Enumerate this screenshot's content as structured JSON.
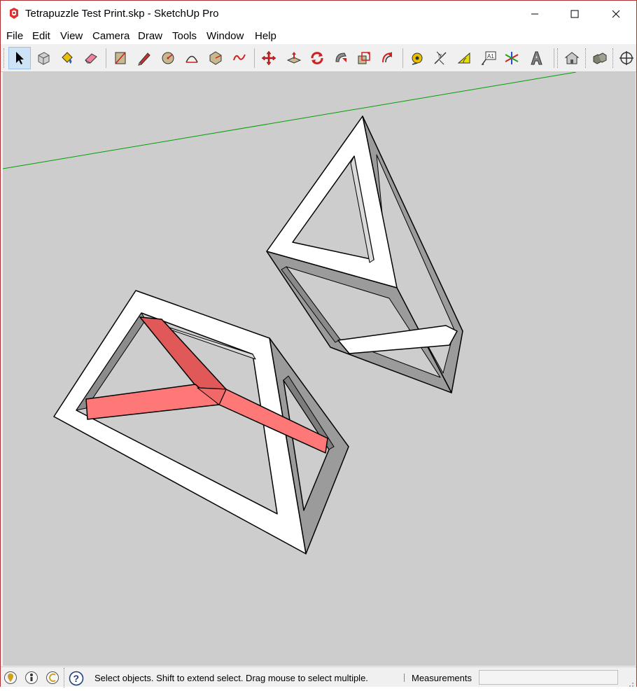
{
  "window": {
    "title": "Tetrapuzzle Test Print.skp - SketchUp Pro"
  },
  "titlebar_buttons": {
    "minimize": "minimize",
    "maximize": "maximize",
    "close": "close"
  },
  "menu": {
    "file": "File",
    "edit": "Edit",
    "view": "View",
    "camera": "Camera",
    "draw": "Draw",
    "tools": "Tools",
    "window": "Window",
    "help": "Help"
  },
  "toolbar": {
    "tools": [
      "select-tool",
      "make-component-tool",
      "paint-bucket-tool",
      "eraser-tool",
      "rectangle-tool",
      "line-tool",
      "circle-tool",
      "arc-tool",
      "polygon-tool",
      "freehand-tool",
      "move-tool",
      "push-pull-tool",
      "rotate-tool",
      "follow-me-tool",
      "scale-tool",
      "offset-tool",
      "tape-measure-tool",
      "dimension-tool",
      "protractor-tool",
      "text-tool",
      "axes-tool",
      "3d-text-tool",
      "warehouse-tool",
      "components-tool",
      "orbit-tool"
    ],
    "active_tool": "select-tool"
  },
  "status": {
    "message": "Select objects. Shift to extend select. Drag mouse to select multiple.",
    "measurements_label": "Measurements",
    "measurements_value": ""
  },
  "colors": {
    "viewport_bg": "#cdcdcd",
    "face_white": "#ffffff",
    "face_gray": "#9b9b9b",
    "face_dark_gray": "#7d7d7d",
    "selected_red": "#ff7878",
    "selected_red_dark": "#e05858",
    "green_axis": "#00a000"
  }
}
